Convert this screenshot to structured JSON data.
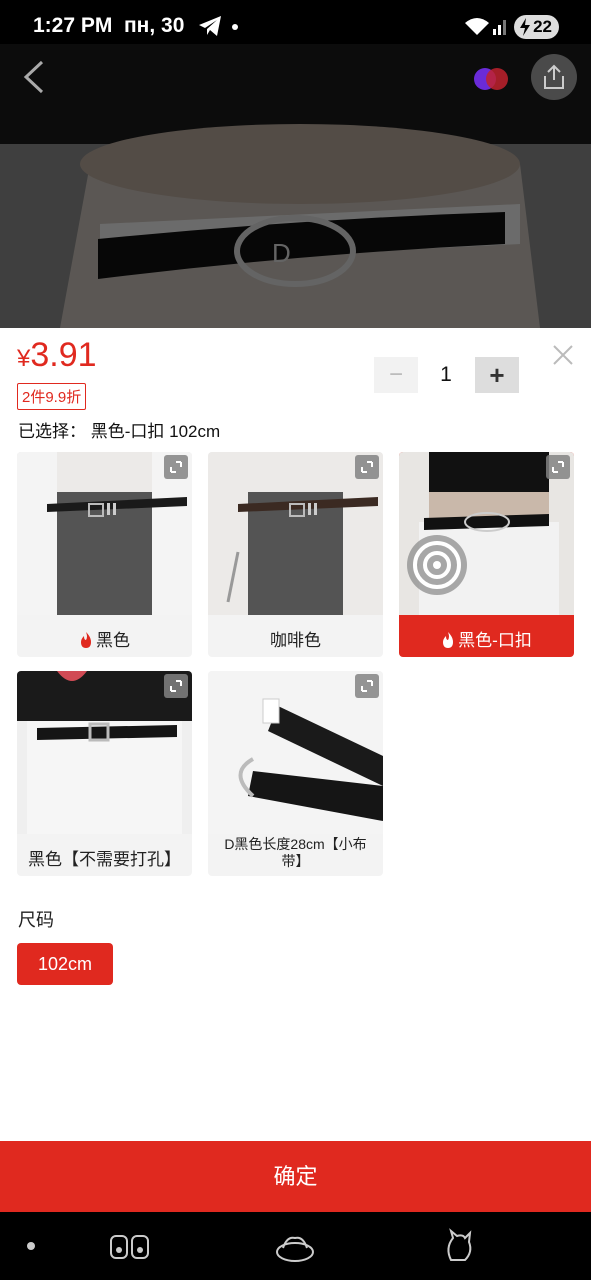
{
  "status_bar": {
    "time": "1:27 PM",
    "date": "пн, 30",
    "battery": "22",
    "icons": [
      "telegram-icon",
      "notification-dot-icon",
      "wifi-icon",
      "signal-icon",
      "battery-icon"
    ]
  },
  "header": {
    "icons": [
      "back-arrow-icon",
      "favorite-icon",
      "share-icon"
    ]
  },
  "product": {
    "currency": "¥",
    "price": "3.91",
    "promo": "2件9.9折",
    "selected_prefix": "已选择：",
    "selected_value": "黑色-口扣 102cm",
    "quantity": "1",
    "minus": "−",
    "plus": "+"
  },
  "options": [
    {
      "label": "黑色",
      "hot": true,
      "selected": false
    },
    {
      "label": "咖啡色",
      "hot": false,
      "selected": false
    },
    {
      "label": "黑色-口扣",
      "hot": true,
      "selected": true
    },
    {
      "label": "黑色【不需要打孔】",
      "hot": false,
      "selected": false
    },
    {
      "label": "D黑色长度28cm【小布带】",
      "hot": false,
      "selected": false
    }
  ],
  "size": {
    "title": "尺码",
    "options": [
      "102cm"
    ]
  },
  "confirm_label": "确定",
  "colors": {
    "accent": "#e0291f",
    "chip_bg": "#f3f3f3"
  }
}
